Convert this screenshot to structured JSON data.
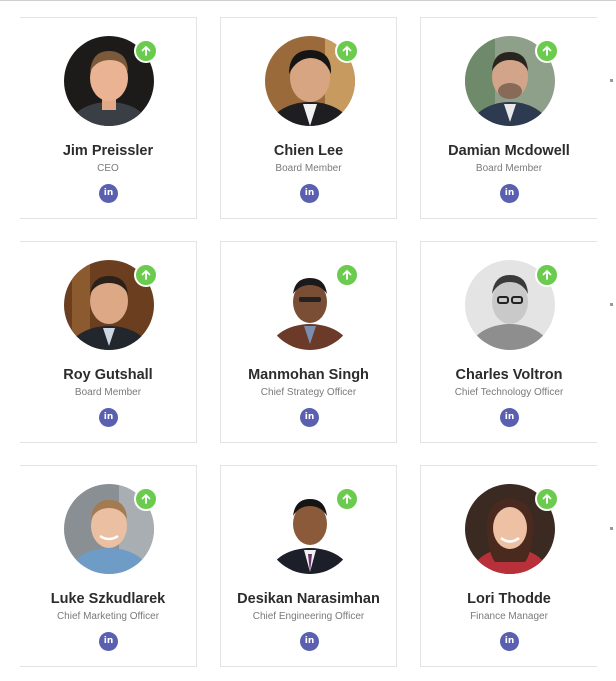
{
  "members": [
    {
      "name": "Jim Preissler",
      "title": "CEO",
      "status_icon": "arrow-up-icon",
      "social_icon": "linkedin-icon",
      "social_label": "in"
    },
    {
      "name": "Chien Lee",
      "title": "Board Member",
      "status_icon": "arrow-up-icon",
      "social_icon": "linkedin-icon",
      "social_label": "in"
    },
    {
      "name": "Damian Mcdowell",
      "title": "Board Member",
      "status_icon": "arrow-up-icon",
      "social_icon": "linkedin-icon",
      "social_label": "in"
    },
    {
      "name": "Roy Gutshall",
      "title": "Board Member",
      "status_icon": "arrow-up-icon",
      "social_icon": "linkedin-icon",
      "social_label": "in"
    },
    {
      "name": "Manmohan Singh",
      "title": "Chief Strategy Officer",
      "status_icon": "arrow-up-icon",
      "social_icon": "linkedin-icon",
      "social_label": "in"
    },
    {
      "name": "Charles Voltron",
      "title": "Chief Technology Officer",
      "status_icon": "arrow-up-icon",
      "social_icon": "linkedin-icon",
      "social_label": "in"
    },
    {
      "name": "Luke Szkudlarek",
      "title": "Chief Marketing Officer",
      "status_icon": "arrow-up-icon",
      "social_icon": "linkedin-icon",
      "social_label": "in"
    },
    {
      "name": "Desikan Narasimhan",
      "title": "Chief Engineering Officer",
      "status_icon": "arrow-up-icon",
      "social_icon": "linkedin-icon",
      "social_label": "in"
    },
    {
      "name": "Lori Thodde",
      "title": "Finance Manager",
      "status_icon": "arrow-up-icon",
      "social_icon": "linkedin-icon",
      "social_label": "in"
    }
  ],
  "colors": {
    "badge": "#6bcb4e",
    "linkedin": "#5a5fb0",
    "name": "#2c2c2c",
    "title": "#7a7a7a",
    "card_border": "#e3e3e3"
  }
}
